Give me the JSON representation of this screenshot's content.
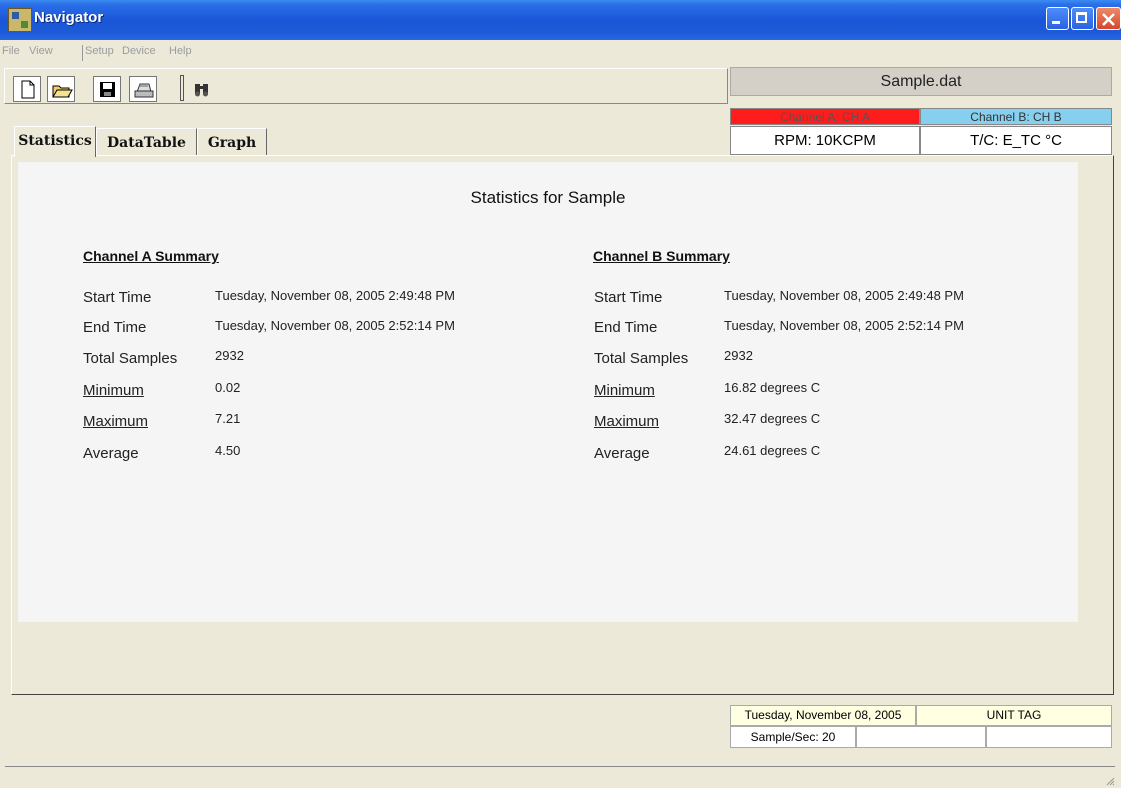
{
  "window": {
    "title": "Navigator"
  },
  "menu": {
    "items": [
      "File",
      "View",
      "Setup",
      "Device",
      "Help"
    ]
  },
  "toolbar": {
    "icons": [
      "new-file-icon",
      "open-folder-icon",
      "save-disk-icon",
      "print-icon",
      "find-binoculars-icon"
    ]
  },
  "header": {
    "file_name": "Sample.dat",
    "channel_a": {
      "label": "Channel A: CH A",
      "unit": "RPM: 10KCPM",
      "color": "#ff1c1c"
    },
    "channel_b": {
      "label": "Channel B: CH B",
      "unit": "T/C: E_TC  °C",
      "color": "#87cfef"
    }
  },
  "tabs": [
    {
      "label": "Statistics",
      "active": true
    },
    {
      "label": "DataTable",
      "active": false
    },
    {
      "label": "Graph",
      "active": false
    }
  ],
  "statistics": {
    "title": "Statistics for Sample",
    "channel_a": {
      "heading": "Channel A Summary",
      "rows": [
        {
          "label": "Start Time",
          "value": "Tuesday, November 08, 2005 2:49:48 PM"
        },
        {
          "label": "End Time",
          "value": "Tuesday, November 08, 2005 2:52:14 PM"
        },
        {
          "label": "Total Samples",
          "value": "2932"
        },
        {
          "label": "Minimum",
          "value": "0.02"
        },
        {
          "label": "Maximum",
          "value": "7.21"
        },
        {
          "label": "Average",
          "value": "4.50"
        }
      ]
    },
    "channel_b": {
      "heading": "Channel B Summary",
      "rows": [
        {
          "label": "Start Time",
          "value": "Tuesday, November 08, 2005 2:49:48 PM"
        },
        {
          "label": "End Time",
          "value": "Tuesday, November 08, 2005 2:52:14 PM"
        },
        {
          "label": "Total Samples",
          "value": "2932"
        },
        {
          "label": "Minimum",
          "value": "16.82 degrees C"
        },
        {
          "label": "Maximum",
          "value": "32.47 degrees C"
        },
        {
          "label": "Average",
          "value": "24.61 degrees C"
        }
      ]
    }
  },
  "status": {
    "date": "Tuesday, November 08, 2005",
    "unit_tag": "UNIT TAG",
    "sample_rate": "Sample/Sec: 20"
  }
}
